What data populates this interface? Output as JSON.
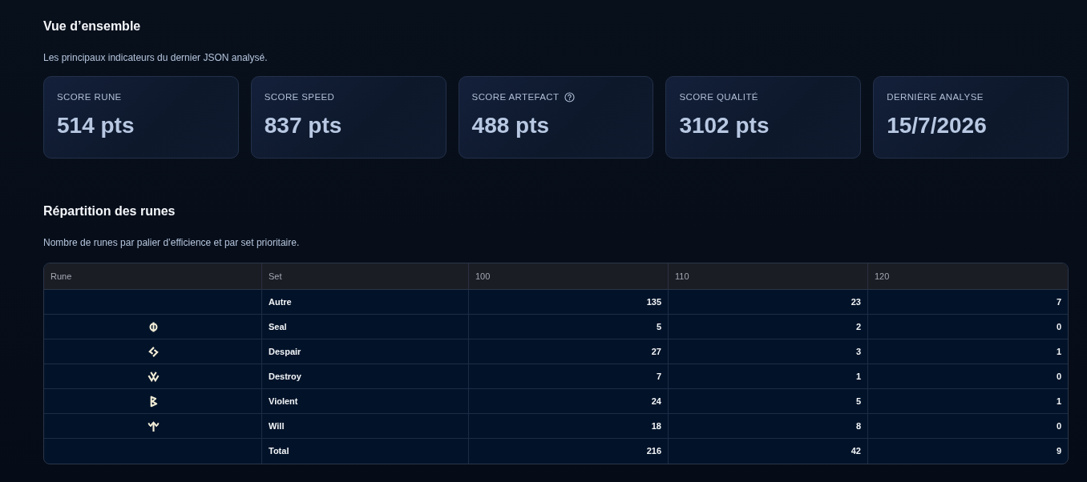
{
  "overview": {
    "title": "Vue d’ensemble",
    "subtitle": "Les principaux indicateurs du dernier JSON analysé.",
    "cards": [
      {
        "label": "SCORE RUNE",
        "value": "514 pts",
        "help": false
      },
      {
        "label": "SCORE SPEED",
        "value": "837 pts",
        "help": false
      },
      {
        "label": "SCORE ARTEFACT",
        "value": "488 pts",
        "help": true
      },
      {
        "label": "SCORE QUALITÉ",
        "value": "3102 pts",
        "help": false
      },
      {
        "label": "DERNIÈRE ANALYSE",
        "value": "15/7/2026",
        "help": false
      }
    ]
  },
  "distribution": {
    "title": "Répartition des runes",
    "subtitle": "Nombre de runes par palier d’efficience et par set prioritaire.",
    "table": {
      "columns": [
        "Rune",
        "Set",
        "100",
        "110",
        "120"
      ],
      "rows": [
        {
          "kind": "plain",
          "set": "Autre",
          "values": [
            "135",
            "23",
            "7"
          ]
        },
        {
          "kind": "seal",
          "set": "Seal",
          "values": [
            "5",
            "2",
            "0"
          ]
        },
        {
          "kind": "despair",
          "set": "Despair",
          "values": [
            "27",
            "3",
            "1"
          ]
        },
        {
          "kind": "destroy",
          "set": "Destroy",
          "values": [
            "7",
            "1",
            "0"
          ]
        },
        {
          "kind": "violent",
          "set": "Violent",
          "values": [
            "24",
            "5",
            "1"
          ]
        },
        {
          "kind": "will",
          "set": "Will",
          "values": [
            "18",
            "8",
            "0"
          ]
        },
        {
          "kind": "plain",
          "set": "Total",
          "values": [
            "216",
            "42",
            "9"
          ]
        }
      ]
    }
  }
}
